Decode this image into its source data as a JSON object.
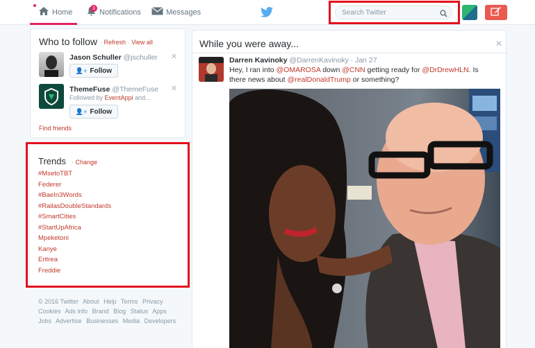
{
  "nav": {
    "home": "Home",
    "notifications": "Notifications",
    "notifications_count": "3",
    "messages": "Messages"
  },
  "search": {
    "placeholder": "Search Twitter"
  },
  "who_to_follow": {
    "title": "Who to follow",
    "refresh": "Refresh",
    "view_all": "View all",
    "separator": "·",
    "suggestions": [
      {
        "name": "Jason Schuller",
        "handle": "@jschuller",
        "follow": "Follow"
      },
      {
        "name": "ThemeFuse",
        "handle": "@ThemeFuse",
        "followed_by_prefix": "Followed by",
        "followed_by_link": "EventAppi",
        "followed_by_suffix": "and...",
        "follow": "Follow"
      }
    ],
    "find_friends": "Find friends"
  },
  "trends": {
    "title": "Trends",
    "change": "Change",
    "items": [
      "#MsetoTBT",
      "Federer",
      "#BaeIn3Words",
      "#RailasDoubleStandards",
      "#SmartCities",
      "#StartUpAfrica",
      "Mpeketoni",
      "Kanye",
      "Eritrea",
      "Freddie"
    ]
  },
  "footer": {
    "links": [
      "© 2016 Twitter",
      "About",
      "Help",
      "Terms",
      "Privacy",
      "Cookies",
      "Ads info",
      "Brand",
      "Blog",
      "Status",
      "Apps",
      "Jobs",
      "Advertise",
      "Businesses",
      "Media",
      "Developers"
    ]
  },
  "away": {
    "title": "While you were away...",
    "tweet": {
      "name": "Darren Kavinoky",
      "handle": "@DarrenKavinoky",
      "dot": "·",
      "date": "Jan 27",
      "text_1": "Hey, I ran into ",
      "mention_1": "@OMAROSA",
      "text_2": " down ",
      "mention_2": "@CNN",
      "text_3": " getting ready for ",
      "mention_3": "@DrDrewHLN",
      "text_4": ". Is there news about ",
      "mention_4": "@realDonaldTrump",
      "text_5": " or something?"
    }
  },
  "colors": {
    "accent": "#c0392b",
    "highlight": "#e3101c",
    "tweet_button": "#e95a4f"
  }
}
